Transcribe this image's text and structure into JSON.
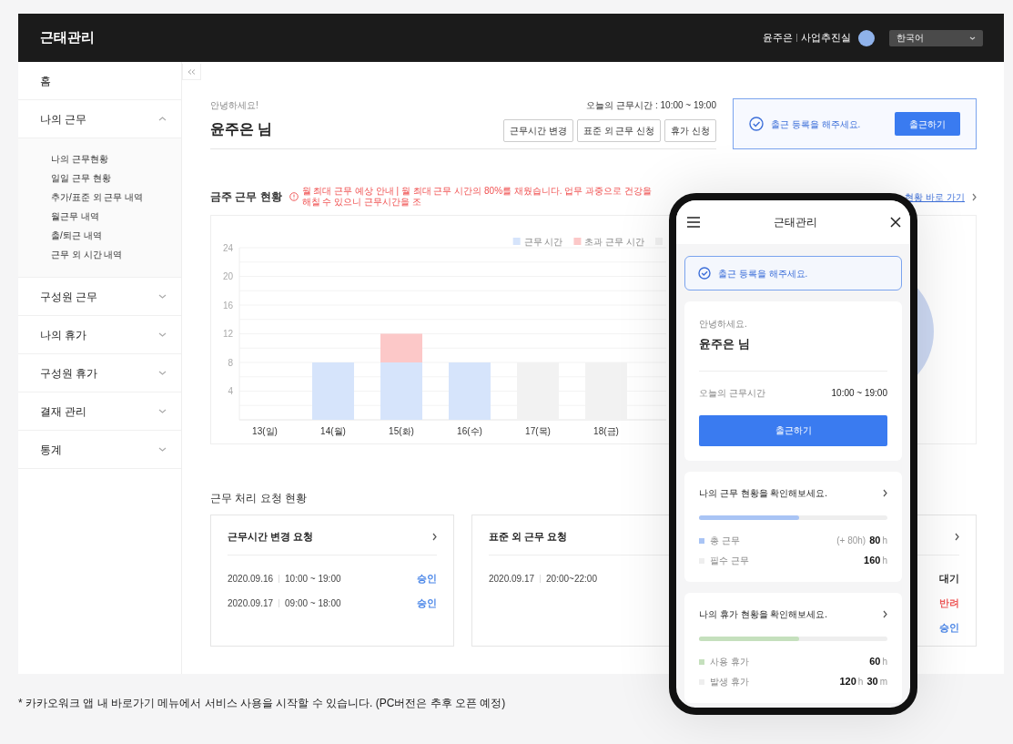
{
  "header": {
    "title": "근태관리",
    "user_name": "윤주은",
    "department": "사업추진실",
    "language": "한국어"
  },
  "sidebar": {
    "items": [
      {
        "label": "홈"
      },
      {
        "label": "나의 근무",
        "expanded": true,
        "children": [
          {
            "label": "나의 근무현황"
          },
          {
            "label": "일일 근무 현황"
          },
          {
            "label": "추가/표준 외 근무 내역"
          },
          {
            "label": "월근무 내역"
          },
          {
            "label": "출/퇴근 내역"
          },
          {
            "label": "근무 외 시간 내역"
          }
        ]
      },
      {
        "label": "구성원 근무",
        "expanded": false
      },
      {
        "label": "나의 휴가",
        "expanded": false
      },
      {
        "label": "구성원 휴가",
        "expanded": false
      },
      {
        "label": "결재 관리",
        "expanded": false
      },
      {
        "label": "통계",
        "expanded": false
      }
    ]
  },
  "greeting": {
    "hello": "안녕하세요!",
    "name": "윤주은 님",
    "work_hours": "오늘의 근무시간 : 10:00 ~ 19:00",
    "buttons": [
      "근무시간 변경",
      "표준 외 근무 신청",
      "휴가 신청"
    ]
  },
  "checkin": {
    "message": "출근 등록을 해주세요.",
    "button": "출근하기"
  },
  "weekly": {
    "title": "금주 근무 현황",
    "warning": "월 최대 근무 예상 안내 | 월 최대 근무 시간의 80%를 채웠습니다. 업무 과중으로 건강을 해칠 수 있으니 근무시간을 조",
    "link": "현황 바로 가기",
    "chart_data": {
      "type": "bar",
      "stacked": true,
      "grid": true,
      "legend": "top-right",
      "categories": [
        "13(일)",
        "14(월)",
        "15(화)",
        "16(수)",
        "17(목)",
        "18(금)"
      ],
      "ylim": [
        0,
        24
      ],
      "yticks": [
        4,
        8,
        12,
        16,
        20,
        24
      ],
      "series": [
        {
          "name": "근무 시간",
          "color": "#d6e4fb",
          "values": [
            null,
            8,
            8,
            8,
            null,
            null
          ]
        },
        {
          "name": "초과 근무 시간",
          "color": "#fcc8c8",
          "values": [
            null,
            null,
            4,
            null,
            null,
            null
          ]
        },
        {
          "color": "#f2f2f2",
          "values": [
            null,
            null,
            null,
            null,
            8,
            8
          ]
        }
      ]
    }
  },
  "requests": {
    "title": "근무 처리 요청 현황",
    "cards": [
      {
        "title": "근무시간 변경 요청",
        "arrow": true,
        "rows": [
          {
            "date": "2020.09.16",
            "time": "10:00 ~ 19:00",
            "status": "승인",
            "color": "#4a86e8"
          },
          {
            "date": "2020.09.17",
            "time": "09:00 ~ 18:00",
            "status": "승인",
            "color": "#4a86e8"
          }
        ]
      },
      {
        "title": "표준 외 근무 요청",
        "arrow": false,
        "rows": [
          {
            "date": "2020.09.17",
            "time": "20:00~22:00"
          }
        ]
      },
      {
        "arrow": true,
        "rows": [
          {
            "status": "대기",
            "color": "#333333"
          },
          {
            "status": "반려",
            "color": "#f05a5a"
          },
          {
            "status": "승인",
            "color": "#4a86e8"
          }
        ]
      }
    ]
  },
  "mobile": {
    "title": "근태관리",
    "checkin_message": "출근 등록을 해주세요.",
    "greeting": "안녕하세요.",
    "name": "윤주은 님",
    "work_hours_label": "오늘의 근무시간",
    "work_hours": "10:00 ~ 19:00",
    "checkin_button": "출근하기",
    "summaries": [
      {
        "title": "나의 근무 현황을 확인해보세요.",
        "level": 0.53,
        "color": "#a9c4f5",
        "rows": [
          {
            "label": "총 근무",
            "note": "(+ 80h)",
            "color": "#a9c4f5",
            "values": [
              {
                "num": "80",
                "unit": "h"
              }
            ]
          },
          {
            "label": "필수 근무",
            "color": "#eeeeee",
            "values": [
              {
                "num": "160",
                "unit": "h"
              }
            ]
          }
        ]
      },
      {
        "title": "나의 휴가 현황을 확인해보세요.",
        "level": 0.53,
        "color": "#c5e0bd",
        "rows": [
          {
            "label": "사용 휴가",
            "color": "#c5e0bd",
            "values": [
              {
                "num": "60",
                "unit": "h"
              }
            ]
          },
          {
            "label": "발생 휴가",
            "color": "#eeeeee",
            "values": [
              {
                "num": "120",
                "unit": "h"
              },
              {
                "num": "30",
                "unit": "m"
              }
            ]
          }
        ]
      }
    ]
  },
  "footnote": "* 카카오워크 앱 내 바로가기 메뉴에서 서비스 사용을 시작할 수 있습니다. (PC버전은 추후 오픈 예정)"
}
